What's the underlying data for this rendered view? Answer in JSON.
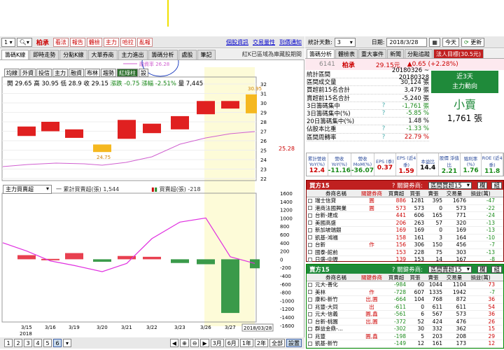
{
  "toolbar": {
    "period": "1",
    "stock_name": "柏承",
    "buttons": [
      "看法",
      "報告",
      "體檢",
      "主力",
      "哈拉",
      "亂報"
    ],
    "links": [
      "個股資訊",
      "交易量性",
      "到價通知"
    ]
  },
  "chart_tabs": [
    "籌碼K線",
    "即時走勢",
    "分點K線",
    "大單券商",
    "主力進出",
    "籌碼分析",
    "處股",
    "筆記"
  ],
  "chart_tab_selected": 0,
  "right_note": "紅K已區域為庫藏股期間",
  "legend_text": "融資率 26.28",
  "chart_buttons": [
    "均線",
    "外資",
    "投信",
    "主力",
    "融資",
    "布林",
    "趨勢",
    "紅綠柱",
    "設"
  ],
  "info": {
    "open_label": "開",
    "open": "29.65",
    "high_label": "高",
    "high": "30.95",
    "low_label": "低",
    "low": "28.9",
    "close_label": "收",
    "close": "29.15",
    "chg_label": "漲跌",
    "chg": "-0.75",
    "pct_label": "漲幅",
    "pct": "-2.51%",
    "vol_label": "量",
    "vol": "7,445"
  },
  "price_axis": [
    "32",
    "31",
    "30",
    "29",
    "28",
    "27",
    "26",
    "25",
    "24",
    "23",
    "22"
  ],
  "price_current": "25.28",
  "candle_hi_label": "30.95",
  "candle_lo_label": "24.75",
  "sub_indicator": "主力買賣超",
  "sub_legend1": "一 累計買賣超(張) 1,544",
  "sub_legend2": "買賣超(張) -218",
  "sub_axis": [
    "1600",
    "1400",
    "1200",
    "1000",
    "800",
    "600",
    "400",
    "200",
    "0",
    "-200",
    "-400",
    "-600",
    "-800",
    "-1000",
    "-1200",
    "-1400",
    "-1600"
  ],
  "x_dates": [
    "3/15",
    "3/16",
    "3/19",
    "3/20",
    "3/21",
    "3/22",
    "3/23",
    "3/26",
    "3/27"
  ],
  "x_year": "2018",
  "x_selected_date": "2018/03/28",
  "bottom_buttons": [
    "1",
    "2",
    "3",
    "4",
    "5",
    "6"
  ],
  "bottom_selected": "6",
  "range_buttons": [
    "3月",
    "6月",
    "1年",
    "2年",
    "全部",
    "設置"
  ],
  "right": {
    "days_label": "統計天數:",
    "days": "3",
    "date_label": "日期:",
    "date": "2018/3/28",
    "today": "今天",
    "refresh": "更新",
    "tabs": [
      "籌碼分析",
      "體檢表",
      "重大事件",
      "新聞",
      "分點追蹤",
      "法人目標(30.5元)"
    ],
    "code": "6141",
    "name": "柏承",
    "price": "29.15元",
    "change": "▲0.65 (+2.28%)"
  },
  "stats": [
    {
      "k": "統計區間",
      "q": "",
      "v": "20180326 ~ 20180328"
    },
    {
      "k": "區間成交量",
      "q": "",
      "v": "30,124 張"
    },
    {
      "k": "買超前15名合計",
      "q": "",
      "v": "3,479 張"
    },
    {
      "k": "賣超前15名合計",
      "q": "",
      "v": "-5,240 張"
    },
    {
      "k": "3日籌碼集中",
      "q": "?",
      "v": "-1,761 張"
    },
    {
      "k": "3日籌碼集中(%)",
      "q": "?",
      "v": "-5.85 %"
    },
    {
      "k": "20日籌碼集中(%)",
      "q": "",
      "v": "1.48 %"
    },
    {
      "k": "佔股本比重",
      "q": "?",
      "v": "-1.33 %"
    },
    {
      "k": "區間周轉率",
      "q": "?",
      "v": "22.79 %"
    }
  ],
  "trend": {
    "title1": "近3天",
    "title2": "主力動向",
    "verdict": "小賣",
    "count": "1,761 張"
  },
  "kpi_labels": [
    "累計營收 YoY(%)",
    "營收 YoY(%)",
    "營收 MoM(%)",
    "EPS (季)",
    "EPS (近4季)",
    "本益比",
    "股價 淨值比",
    "殖利率 (%)",
    "ROE (近4季)"
  ],
  "kpi_values": [
    "12.4",
    "-11.16",
    "-36.07",
    "0.37",
    "1.59",
    "14.4",
    "2.21",
    "1.76",
    "11.8"
  ],
  "buy": {
    "title": "買方15",
    "hint": "? 關鍵券商:",
    "select": "區間買超15",
    "btns": [
      "欄",
      "組"
    ],
    "cols": [
      "",
      "券商名稱",
      "關鍵券商",
      "買賣超",
      "買張",
      "賣張",
      "交易量",
      "損益(萬)"
    ],
    "rows": [
      [
        "瑞士信貸",
        "圓",
        "886",
        "1281",
        "395",
        "1676",
        "-47"
      ],
      [
        "港商法國興業",
        "圓",
        "573",
        "573",
        "0",
        "573",
        "-22"
      ],
      [
        "台新-建成",
        "",
        "441",
        "606",
        "165",
        "771",
        "-24"
      ],
      [
        "美國高盛",
        "",
        "206",
        "263",
        "57",
        "320",
        "-13"
      ],
      [
        "新加坡瑞銀",
        "",
        "169",
        "169",
        "0",
        "169",
        "-13"
      ],
      [
        "凱基-鴻福",
        "",
        "158",
        "161",
        "3",
        "164",
        "-10"
      ],
      [
        "台新",
        "作",
        "156",
        "306",
        "150",
        "456",
        "-7"
      ],
      [
        "國泰-館前",
        "",
        "153",
        "228",
        "75",
        "303",
        "-13"
      ],
      [
        "日盛-中壢",
        "",
        "139",
        "153",
        "14",
        "167",
        "-8"
      ]
    ]
  },
  "sell": {
    "title": "賣方15",
    "hint": "? 關鍵券商:",
    "select": "區間賣超15",
    "btns": [
      "欄",
      "組"
    ],
    "cols": [
      "",
      "券商名稱",
      "關鍵券商",
      "買賣超",
      "買張",
      "賣張",
      "交易量",
      "損益(萬)"
    ],
    "rows": [
      [
        "元大-善化",
        "",
        "-984",
        "60",
        "1044",
        "1104",
        "73"
      ],
      [
        "美林",
        "作",
        "-728",
        "607",
        "1335",
        "1942",
        "-7"
      ],
      [
        "康和-新竹",
        "出,圓",
        "-664",
        "104",
        "768",
        "872",
        "36"
      ],
      [
        "兆豐-大同",
        "出",
        "-611",
        "0",
        "611",
        "611",
        "54"
      ],
      [
        "元大-信義",
        "圓,鑫",
        "-561",
        "6",
        "567",
        "573",
        "36"
      ],
      [
        "台新-桃園",
        "出,圓",
        "-372",
        "52",
        "424",
        "476",
        "26"
      ],
      [
        "群益金鼎-...",
        "",
        "-302",
        "30",
        "332",
        "362",
        "15"
      ],
      [
        "兆豐",
        "圓,鑫",
        "-198",
        "5",
        "203",
        "208",
        "29"
      ],
      [
        "凱基-新竹",
        "",
        "-149",
        "12",
        "161",
        "173",
        "12"
      ]
    ]
  }
}
